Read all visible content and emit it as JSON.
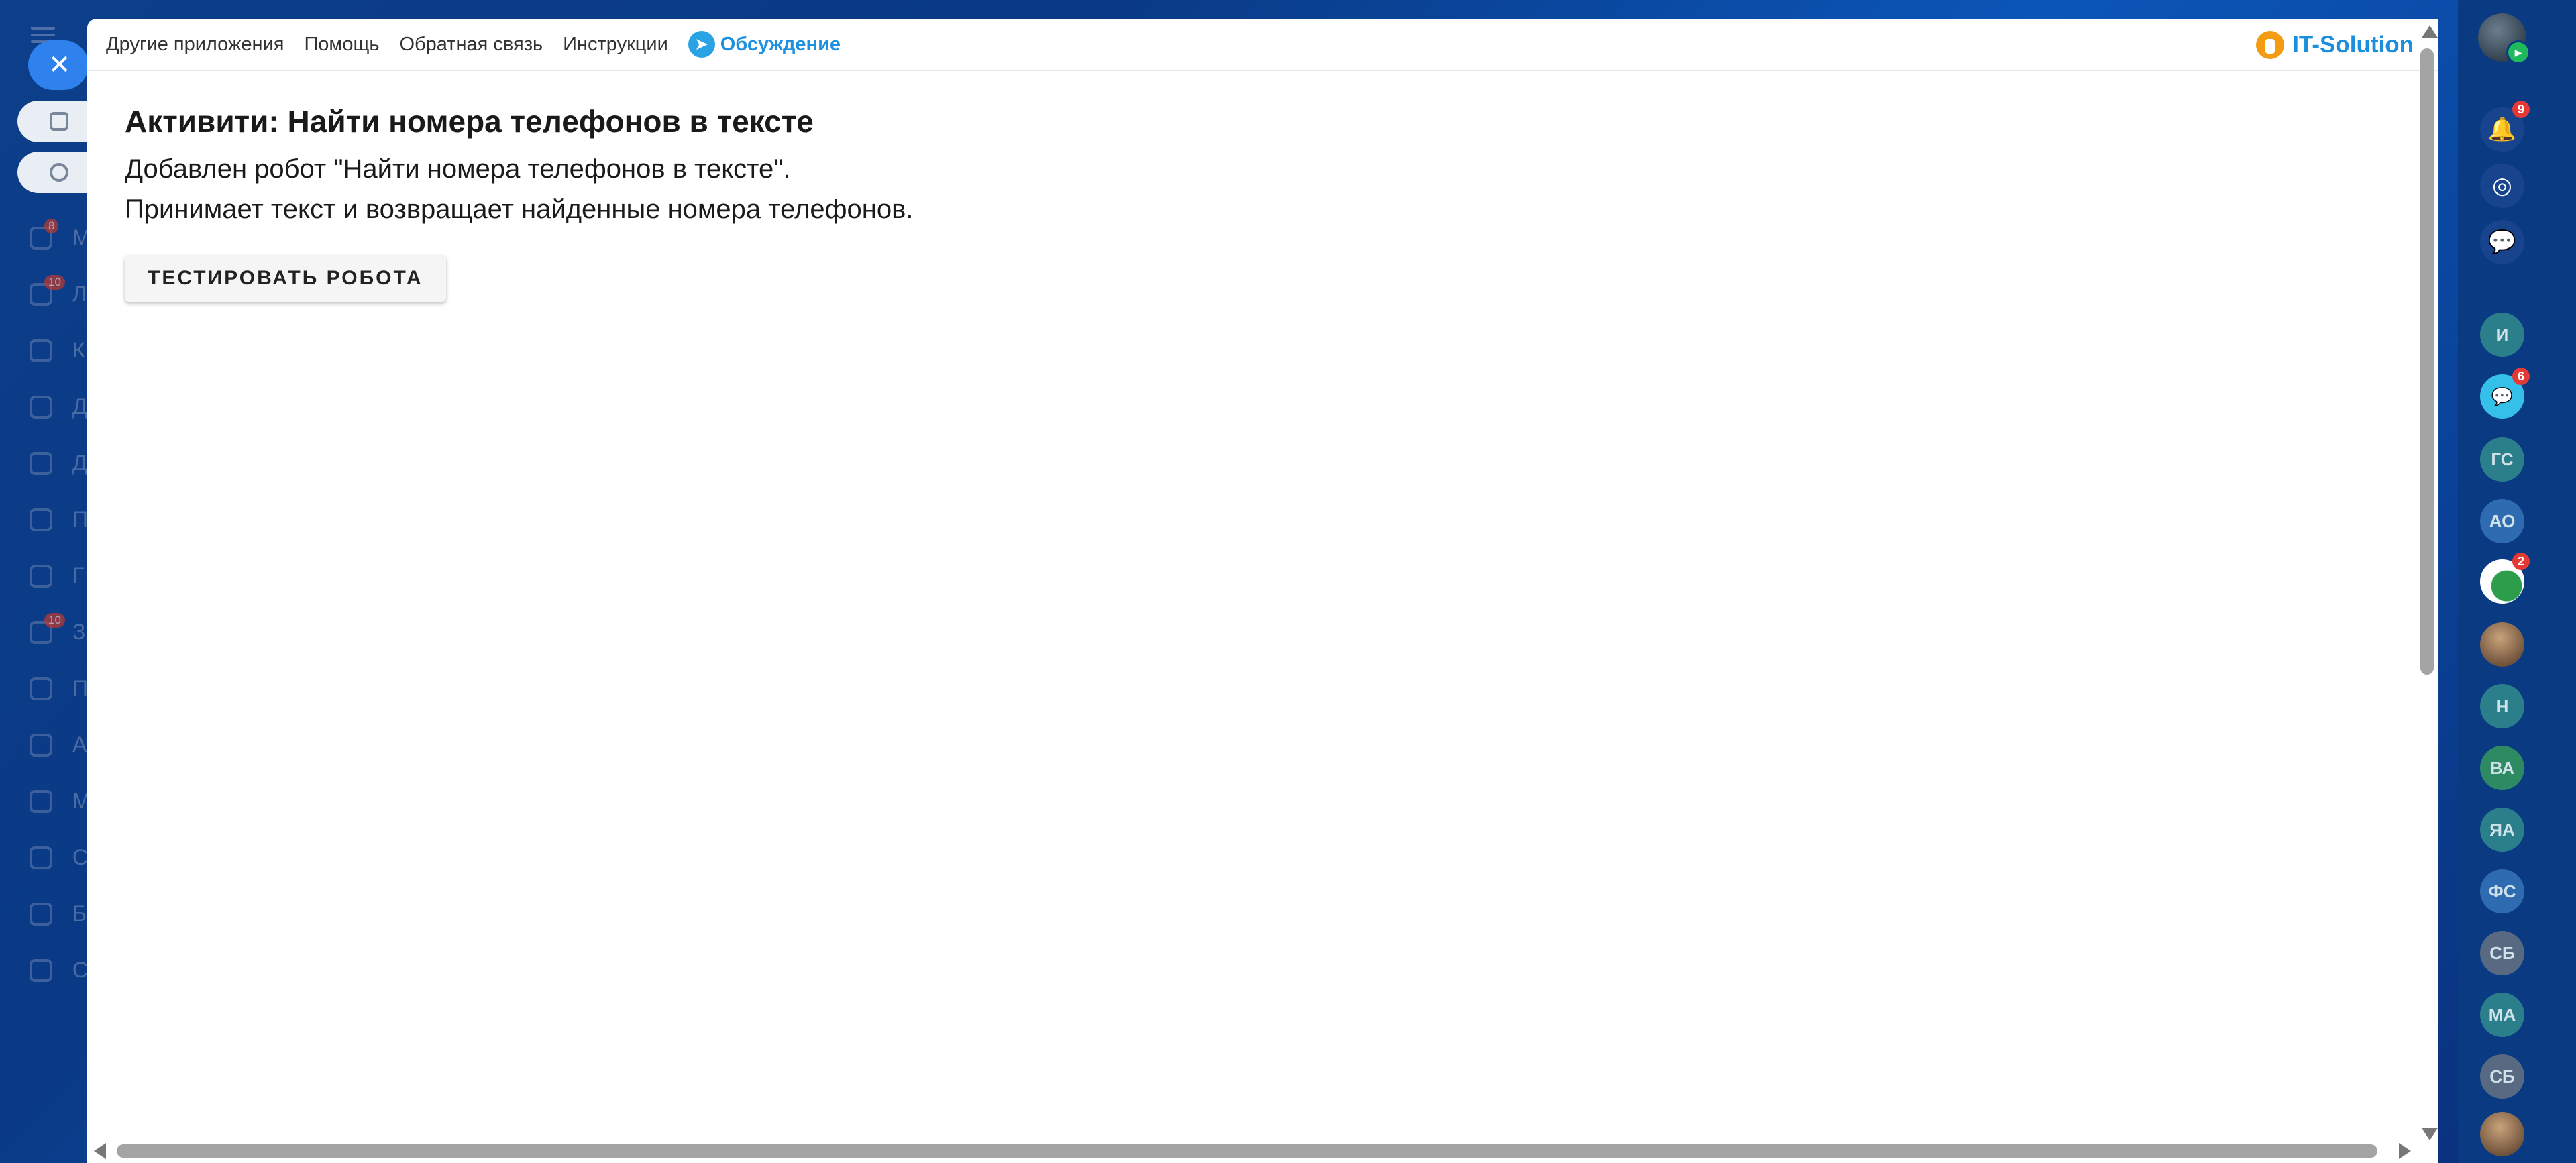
{
  "background": {
    "sidebar_counts": [
      "8",
      "10",
      "10"
    ],
    "sidebar_letters": [
      "М",
      "Л",
      "К",
      "Д",
      "Д",
      "П",
      "Г",
      "З",
      "П",
      "А",
      "М",
      "С",
      "Б",
      "С"
    ]
  },
  "topnav": {
    "links": [
      "Другие приложения",
      "Помощь",
      "Обратная связь",
      "Инструкции"
    ],
    "discussion": "Обсуждение",
    "brand": "IT-Solution"
  },
  "content": {
    "title": "Активити: Найти номера телефонов в тексте",
    "line1": "Добавлен робот \"Найти номера телефонов в тексте\".",
    "line2": "Принимает текст и возвращает найденные номера телефонов.",
    "test_button": "ТЕСТИРОВАТЬ РОБОТА"
  },
  "rail": {
    "notifications_count": "9",
    "chat_count": "6",
    "owl_count": "2",
    "avatars": [
      "И",
      "ГС",
      "АО",
      "Н",
      "ВА",
      "ЯА",
      "ФС",
      "СБ",
      "МА",
      "СБ"
    ],
    "colors": {
      "teal": "#2b7f8a",
      "blue": "#2f6bb0",
      "green": "#2e8a62",
      "gray": "#586a82"
    }
  }
}
